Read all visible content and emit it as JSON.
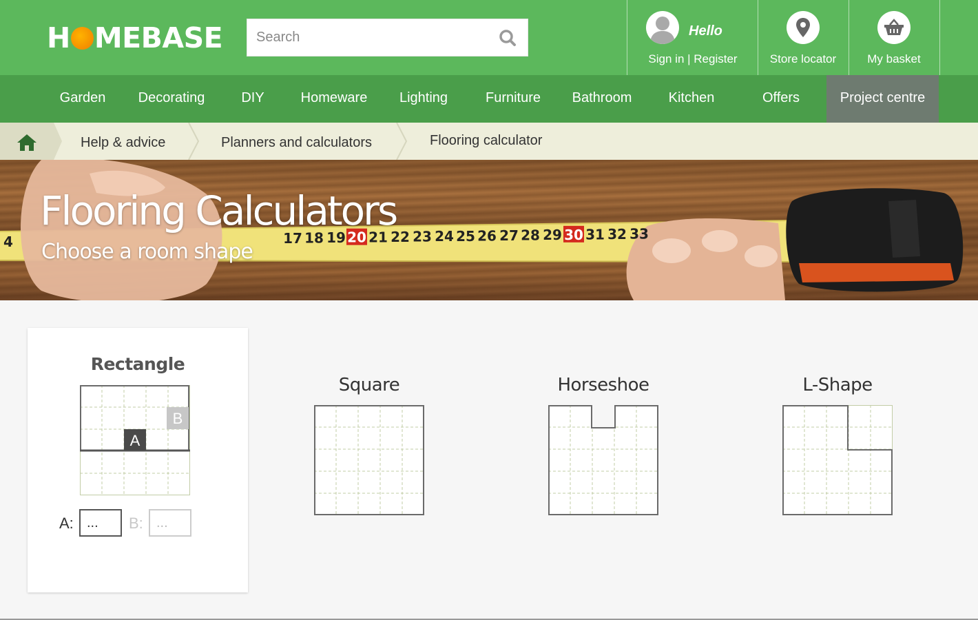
{
  "header": {
    "logo_before": "H",
    "logo_after": "MEBASE",
    "search_placeholder": "Search",
    "hello": "Hello",
    "signin": "Sign in | Register",
    "store_locator": "Store locator",
    "basket": "My basket"
  },
  "nav": {
    "items": [
      "Garden",
      "Decorating",
      "DIY",
      "Homeware",
      "Lighting",
      "Furniture",
      "Bathroom",
      "Kitchen",
      "Offers",
      "Project centre"
    ],
    "active": "Project centre"
  },
  "breadcrumb": [
    "Help & advice",
    "Planners and calculators",
    "Flooring calculator"
  ],
  "hero": {
    "title": "Flooring Calculators",
    "subtitle": "Choose a room shape",
    "tape_numbers": [
      "4",
      "17",
      "18",
      "19",
      "20",
      "21",
      "22",
      "23",
      "24",
      "25",
      "26",
      "27",
      "28",
      "29",
      "30",
      "31",
      "32",
      "33"
    ]
  },
  "shapes": {
    "rectangle": {
      "title": "Rectangle",
      "label_a": "A",
      "label_b": "B"
    },
    "square": {
      "title": "Square"
    },
    "horseshoe": {
      "title": "Horseshoe"
    },
    "lshape": {
      "title": "L-Shape"
    }
  },
  "inputs": {
    "a_label": "A:",
    "b_label": "B:",
    "a_placeholder": "...",
    "b_placeholder": "..."
  },
  "colors": {
    "header_green": "#5cb85c",
    "nav_green": "#4a9e4a",
    "active_nav": "#6e7b70",
    "breadcrumb_bg": "#eeeedb",
    "home_icon": "#2e6b2e",
    "grid_dash": "#b8c49a"
  }
}
